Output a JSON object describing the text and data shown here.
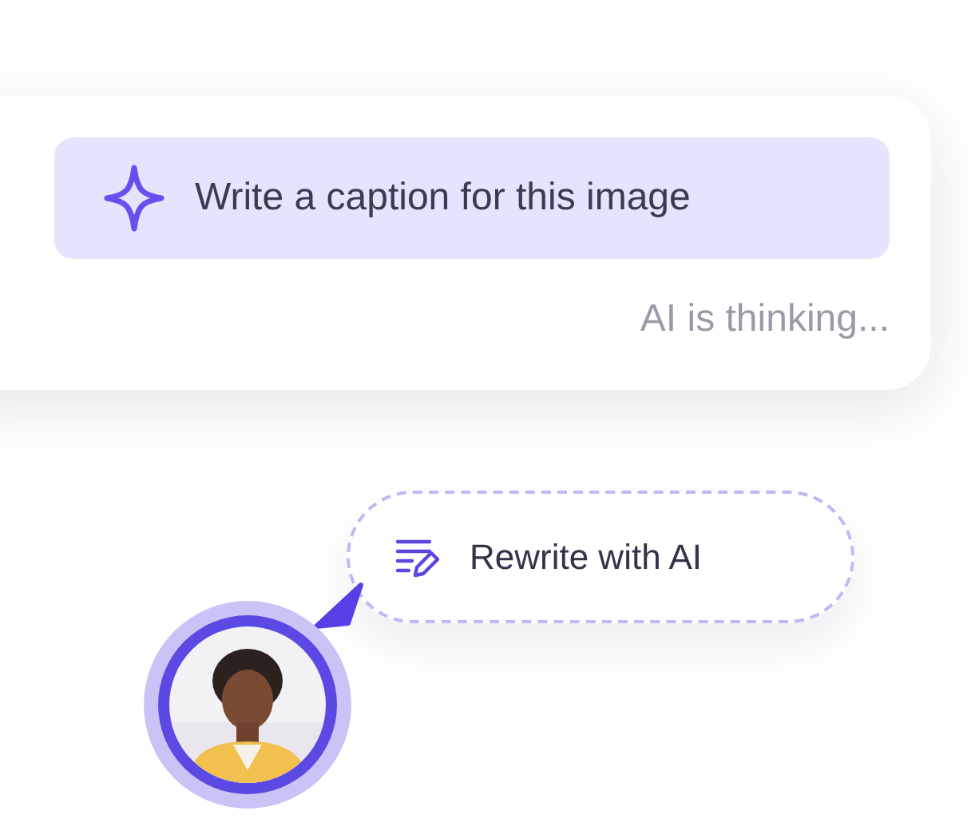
{
  "prompt_card": {
    "prompt": "Write a caption for this image",
    "status": "AI is thinking..."
  },
  "rewrite_button": {
    "label": "Rewrite with AI"
  }
}
